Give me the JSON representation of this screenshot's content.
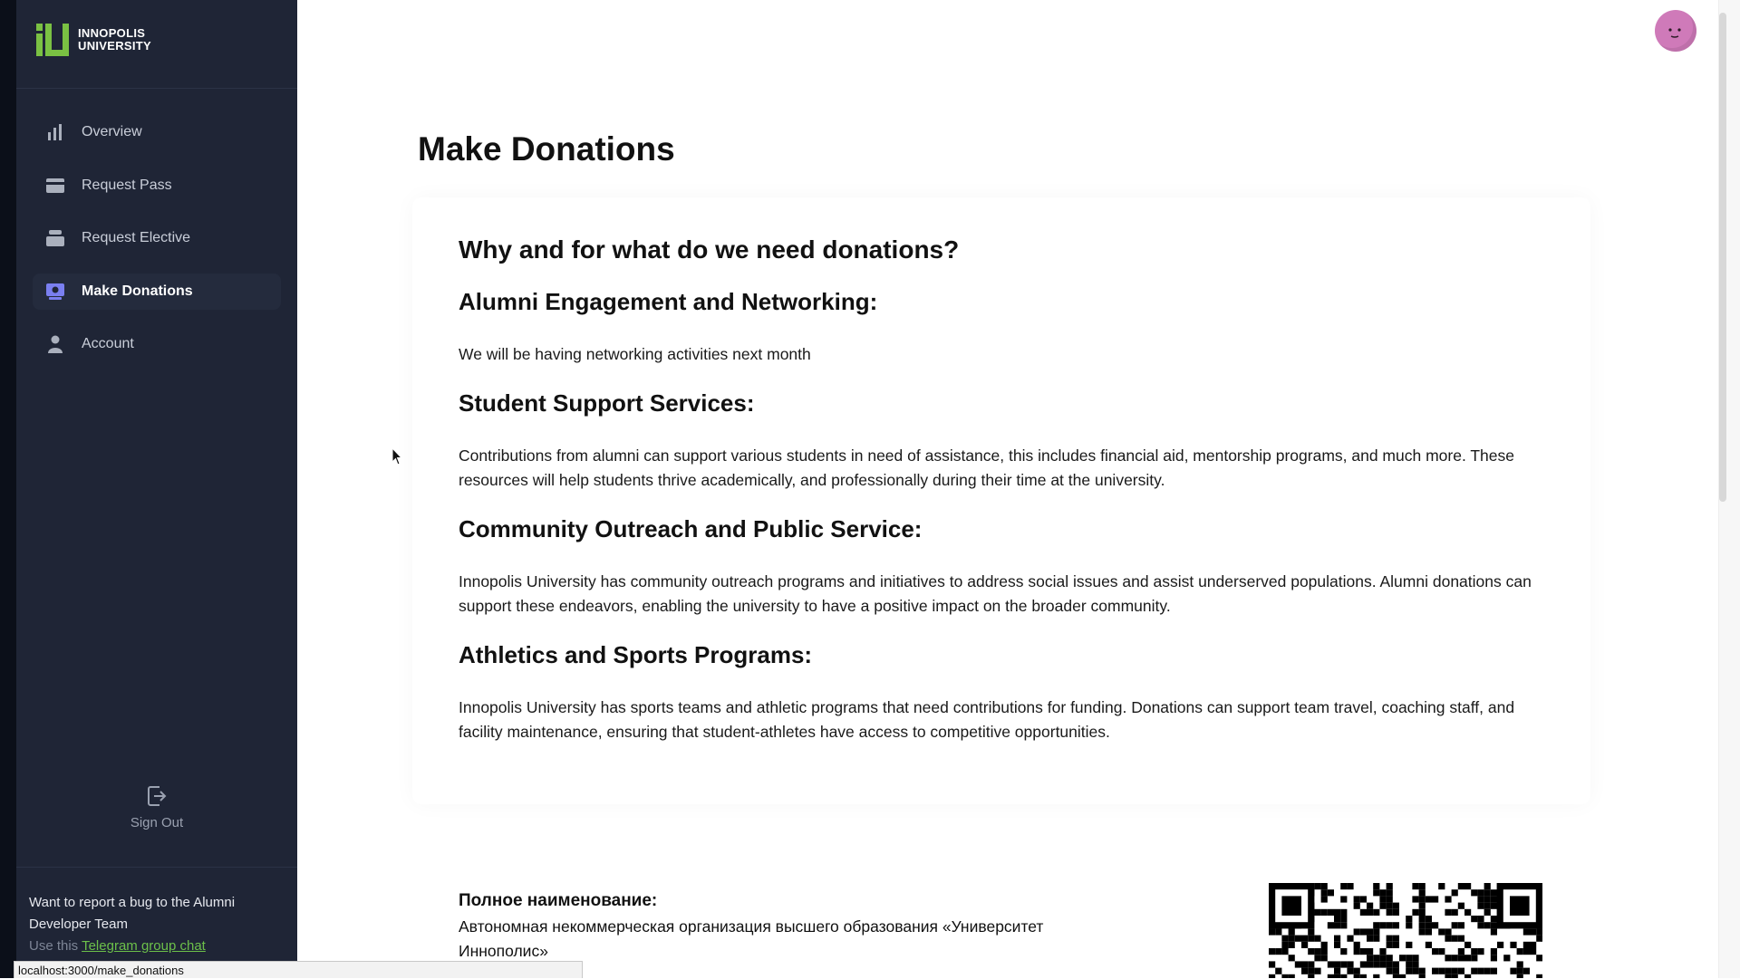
{
  "app": {
    "logo_line1": "INNOPOLIS",
    "logo_line2": "UNIVERSITY",
    "brand_color": "#7ac143"
  },
  "sidebar": {
    "items": [
      {
        "label": "Overview",
        "icon": "bar-chart-icon",
        "active": false
      },
      {
        "label": "Request Pass",
        "icon": "card-icon",
        "active": false
      },
      {
        "label": "Request Elective",
        "icon": "stack-icon",
        "active": false
      },
      {
        "label": "Make Donations",
        "icon": "donation-icon",
        "active": true
      },
      {
        "label": "Account",
        "icon": "user-icon",
        "active": false
      }
    ],
    "sign_out_label": "Sign Out",
    "bug_report": {
      "text": "Want to report a bug to the Alumni Developer Team",
      "sub_prefix": "Use this",
      "link_text": "Telegram group chat"
    }
  },
  "main": {
    "title": "Make Donations",
    "question": "Why and for what do we need donations?",
    "sections": [
      {
        "heading": "Alumni Engagement and Networking:",
        "text": "We will be having networking activities next month"
      },
      {
        "heading": "Student Support Services:",
        "text": "Contributions from alumni can support various students in need of assistance, this includes financial aid, mentorship programs, and much more. These resources will help students thrive academically, and professionally during their time at the university."
      },
      {
        "heading": "Community Outreach and Public Service:",
        "text": "Innopolis University has community outreach programs and initiatives to address social issues and assist underserved populations. Alumni donations can support these endeavors, enabling the university to have a positive impact on the broader community."
      },
      {
        "heading": "Athletics and Sports Programs:",
        "text": "Innopolis University has sports teams and athletic programs that need contributions for funding. Donations can support team travel, coaching staff, and facility maintenance, ensuring that student-athletes have access to competitive opportunities."
      }
    ],
    "requisites": {
      "label": "Полное наименование:",
      "value": "Автономная некоммерческая организация высшего образования «Университет Иннополис»"
    }
  },
  "status_bar": {
    "url": "localhost:3000/make_donations"
  }
}
